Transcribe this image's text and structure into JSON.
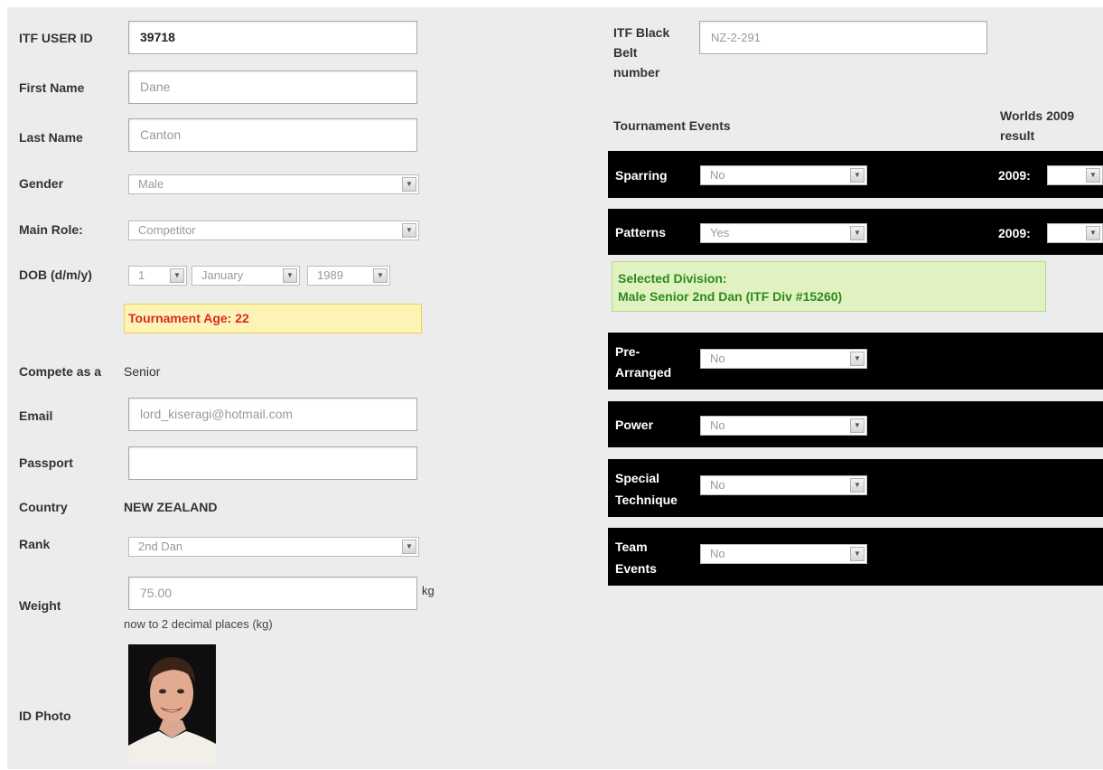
{
  "left": {
    "user_id": {
      "label": "ITF USER ID",
      "value": "39718"
    },
    "first_name": {
      "label": "First Name",
      "value": "Dane"
    },
    "last_name": {
      "label": "Last Name",
      "value": "Canton"
    },
    "gender": {
      "label": "Gender",
      "value": "Male"
    },
    "main_role": {
      "label": "Main Role:",
      "value": "Competitor"
    },
    "dob": {
      "label": "DOB (d/m/y)",
      "day": "1",
      "month": "January",
      "year": "1989"
    },
    "tournament_age": "Tournament Age: 22",
    "compete_as": {
      "label": "Compete as a",
      "value": "Senior"
    },
    "email": {
      "label": "Email",
      "value": "lord_kiseragi@hotmail.com"
    },
    "passport": {
      "label": "Passport",
      "value": ""
    },
    "country": {
      "label": "Country",
      "value": "NEW ZEALAND"
    },
    "rank": {
      "label": "Rank",
      "value": "2nd Dan"
    },
    "weight": {
      "label": "Weight",
      "value": "75.00",
      "unit": "kg",
      "hint": "now to 2 decimal places (kg)"
    },
    "photo": {
      "label": "ID Photo"
    }
  },
  "right": {
    "black_belt": {
      "label_lines": [
        "ITF Black",
        "Belt",
        "number"
      ],
      "value": "NZ-2-291"
    },
    "events_header": "Tournament Events",
    "worlds_header_lines": [
      "Worlds 2009",
      "result"
    ],
    "events": [
      {
        "label_lines": [
          "Sparring"
        ],
        "value": "No",
        "year_label": "2009:"
      },
      {
        "label_lines": [
          "Patterns"
        ],
        "value": "Yes",
        "year_label": "2009:"
      },
      {
        "label_lines": [
          "Pre-",
          "Arranged"
        ],
        "value": "No"
      },
      {
        "label_lines": [
          "Power"
        ],
        "value": "No"
      },
      {
        "label_lines": [
          "Special",
          "Technique"
        ],
        "value": "No"
      },
      {
        "label_lines": [
          "Team",
          "Events"
        ],
        "value": "No"
      }
    ],
    "division": {
      "line1": "Selected Division:",
      "line2": "Male Senior 2nd Dan (ITF Div #15260)"
    }
  },
  "colors": {
    "panel": "#ececec",
    "event_bar": "#000000",
    "warning_bg": "#fdf3b5",
    "warning_text": "#d92b1f",
    "success_bg": "#dff2bf",
    "success_text": "#2f8a1e"
  }
}
